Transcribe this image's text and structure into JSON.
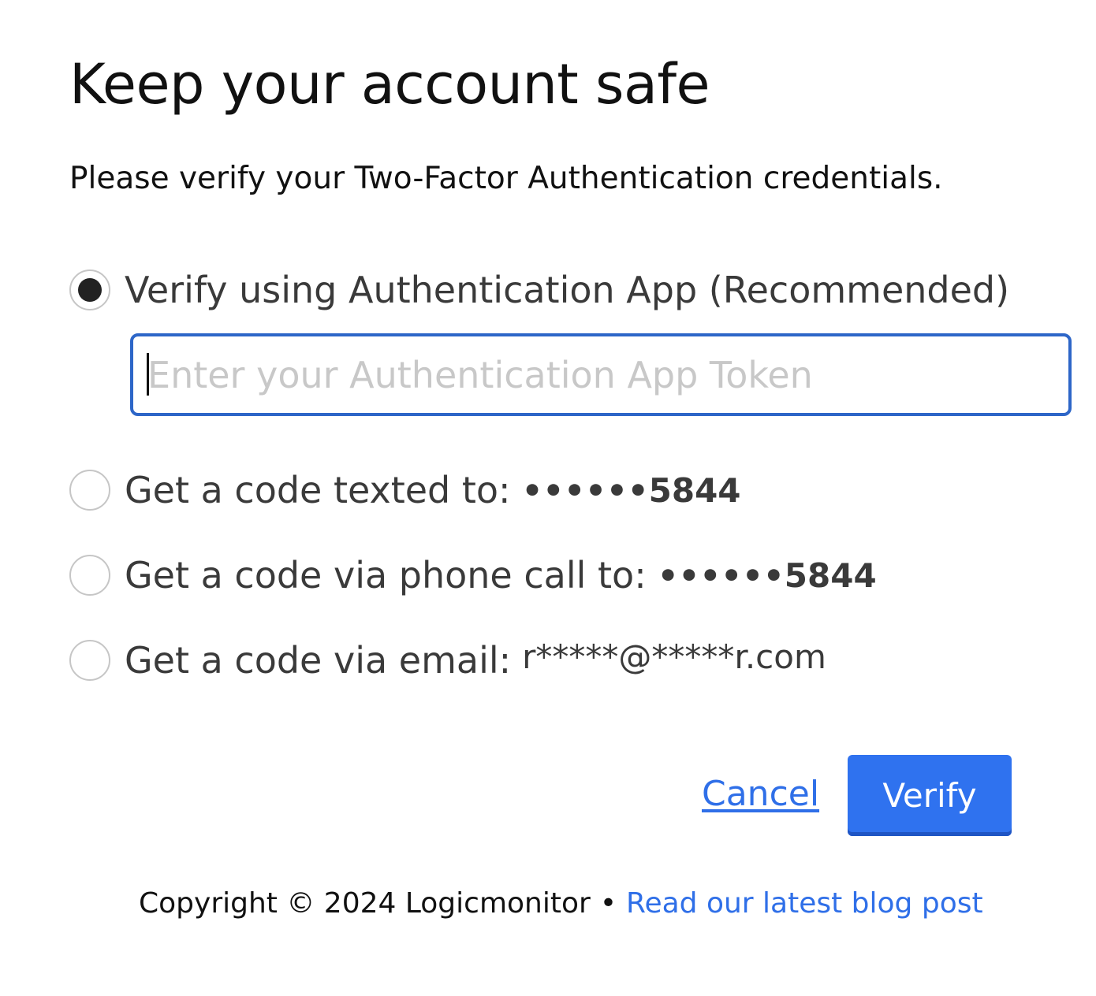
{
  "page": {
    "title": "Keep your account safe",
    "subtitle": "Please verify your Two-Factor Authentication credentials."
  },
  "options": [
    {
      "label": "Verify using Authentication App (Recommended)",
      "value": "",
      "selected": true
    },
    {
      "label": "Get a code texted to:",
      "value": "••••••5844",
      "selected": false
    },
    {
      "label": "Get a code via phone call to:",
      "value": "••••••5844",
      "selected": false
    },
    {
      "label": "Get a code via email:",
      "value": "r*****@*****r.com",
      "selected": false
    }
  ],
  "token_input": {
    "placeholder": "Enter your Authentication App Token",
    "value": ""
  },
  "actions": {
    "cancel_label": "Cancel",
    "verify_label": "Verify"
  },
  "footer": {
    "copyright": "Copyright © 2024 Logicmonitor",
    "separator": "•",
    "blog_link": "Read our latest blog post"
  },
  "colors": {
    "accent": "#2f72ef",
    "link": "#2f6fe8",
    "input_border": "#2d66c8",
    "placeholder": "#c8c8c8"
  }
}
